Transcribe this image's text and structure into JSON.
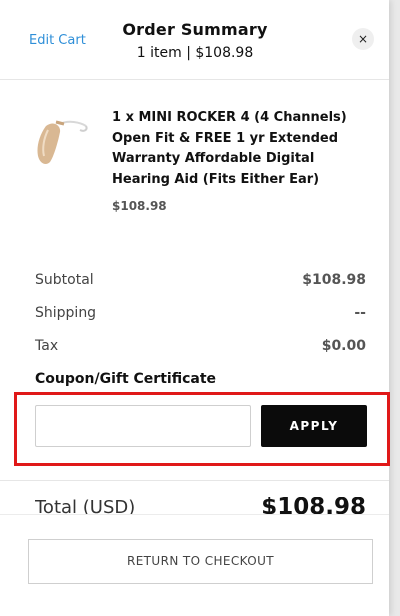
{
  "header": {
    "edit_cart": "Edit Cart",
    "title": "Order Summary",
    "subtitle": "1 item | $108.98",
    "close_icon": "×"
  },
  "item": {
    "image_icon": "hearing-aid-image",
    "name": "1 x MINI ROCKER 4 (4 Channels) Open Fit & FREE 1 yr Extended Warranty Affordable Digital Hearing Aid (Fits Either Ear)",
    "price": "$108.98"
  },
  "summary": {
    "subtotal_label": "Subtotal",
    "subtotal_value": "$108.98",
    "shipping_label": "Shipping",
    "shipping_value": "--",
    "tax_label": "Tax",
    "tax_value": "$0.00"
  },
  "coupon": {
    "title": "Coupon/Gift Certificate",
    "input_value": "",
    "apply_label": "APPLY",
    "highlight_color": "#e01818"
  },
  "total": {
    "label": "Total (USD)",
    "value": "$108.98"
  },
  "footer": {
    "return_label": "RETURN TO CHECKOUT"
  },
  "colors": {
    "link": "#2f8fd8",
    "button_dark": "#0b0b0b"
  }
}
